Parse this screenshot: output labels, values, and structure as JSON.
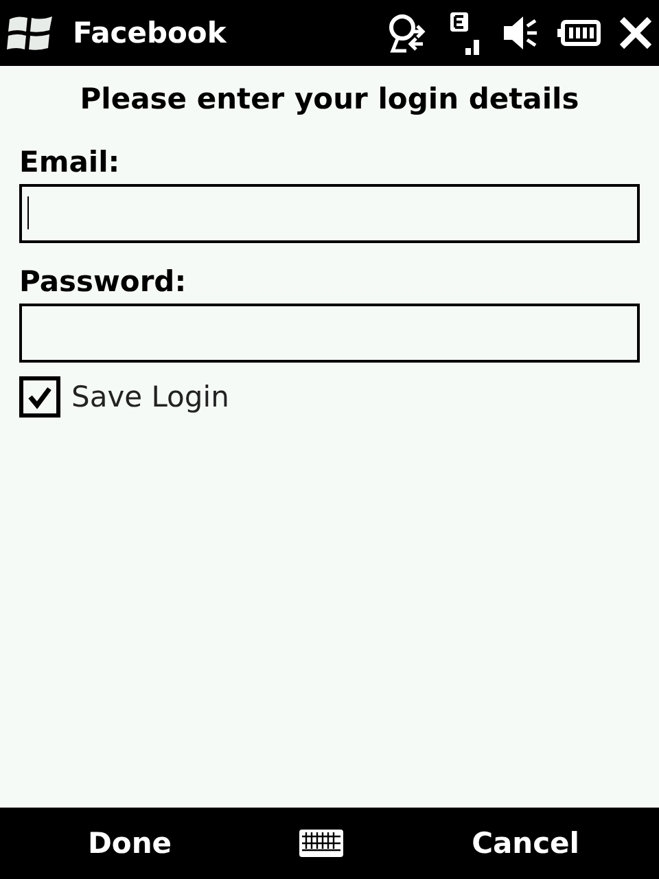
{
  "title_bar": {
    "title": "Facebook"
  },
  "heading": "Please enter your login details",
  "fields": [
    {
      "label": "Email:",
      "focused": true
    },
    {
      "label": "Password:",
      "focused": false
    }
  ],
  "save_login": {
    "label": "Save Login",
    "checked": true
  },
  "soft_keys": {
    "left": "Done",
    "right": "Cancel"
  }
}
